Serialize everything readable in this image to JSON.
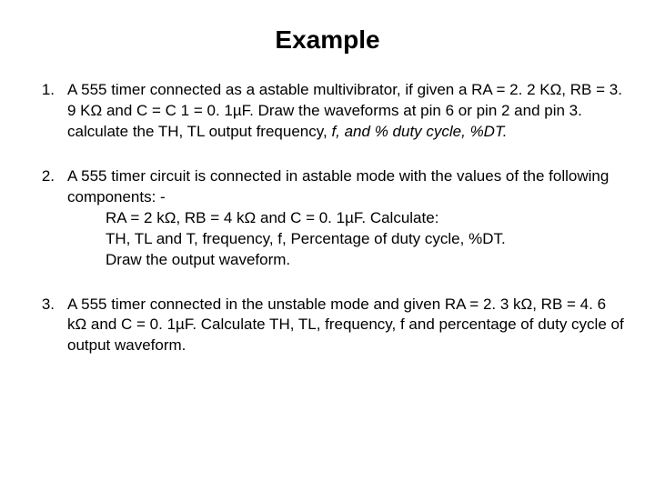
{
  "title": "Example",
  "items": [
    {
      "num": "1.",
      "para1a": "A 555 timer connected as a astable multivibrator, if given a RA = 2. 2 KΩ, RB = 3. 9 KΩ and C = C 1 = 0. 1µF. Draw the waveforms at pin 6 or pin 2 and pin 3. calculate the TH, TL output frequency, ",
      "para1b": "f, and % duty cycle, %DT."
    },
    {
      "num": "2.",
      "para1": "A 555 timer circuit is connected in astable mode with the values of the following components: -",
      "sub1": "RA = 2 kΩ, RB = 4 kΩ and C = 0. 1µF. Calculate:",
      "sub2": "TH, TL and T, frequency, f, Percentage of duty cycle, %DT.",
      "sub3": "Draw the output waveform."
    },
    {
      "num": "3.",
      "para1": "A 555 timer connected in the unstable mode and given RA = 2. 3 kΩ, RB = 4. 6 kΩ and C = 0. 1µF. Calculate TH, TL, frequency, f and percentage of duty cycle of output waveform."
    }
  ]
}
